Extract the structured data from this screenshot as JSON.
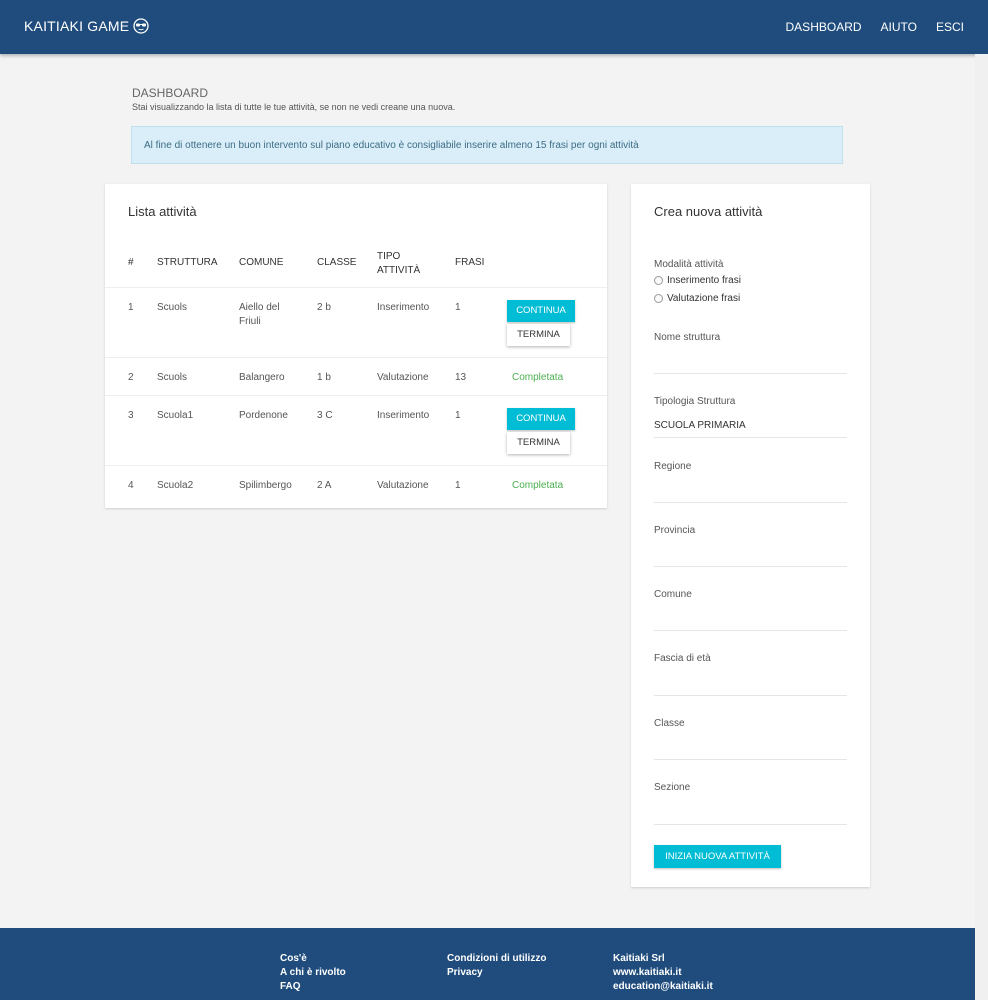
{
  "navbar": {
    "brand": "KAITIAKI GAME",
    "links": [
      "DASHBOARD",
      "AIUTO",
      "ESCI"
    ]
  },
  "page": {
    "title": "DASHBOARD",
    "subtitle": "Stai visualizzando la lista di tutte le tue attività, se non ne vedi creane una nuova."
  },
  "alert": "Al fine di ottenere un buon intervento sul piano educativo è consigliabile inserire almeno 15 frasi per ogni attività",
  "list": {
    "title": "Lista attività",
    "headers": [
      "#",
      "STRUTTURA",
      "COMUNE",
      "CLASSE",
      "TIPO ATTIVITÀ",
      "FRASI"
    ],
    "rows": [
      {
        "num": "1",
        "struttura": "Scuols",
        "comune": "Aiello del Friuli",
        "classe": "2 b",
        "tipo": "Inserimento",
        "frasi": "1",
        "continua": "CONTINUA",
        "termina": "TERMINA"
      },
      {
        "num": "2",
        "struttura": "Scuols",
        "comune": "Balangero",
        "classe": "1 b",
        "tipo": "Valutazione",
        "frasi": "13",
        "status": "Completata"
      },
      {
        "num": "3",
        "struttura": "Scuola1",
        "comune": "Pordenone",
        "classe": "3 C",
        "tipo": "Inserimento",
        "frasi": "1",
        "continua": "CONTINUA",
        "termina": "TERMINA"
      },
      {
        "num": "4",
        "struttura": "Scuola2",
        "comune": "Spilimbergo",
        "classe": "2 A",
        "tipo": "Valutazione",
        "frasi": "1",
        "status": "Completata"
      }
    ]
  },
  "form": {
    "title": "Crea nuova attività",
    "modalita_label": "Modalità attività",
    "modalita_options": [
      "Inserimento frasi",
      "Valutazione frasi"
    ],
    "fields": {
      "nome_struttura": "Nome struttura",
      "tipologia": "Tipologia Struttura",
      "tipologia_value": "SCUOLA PRIMARIA",
      "regione": "Regione",
      "provincia": "Provincia",
      "comune": "Comune",
      "fascia": "Fascia di età",
      "classe": "Classe",
      "sezione": "Sezione"
    },
    "submit": "INIZIA NUOVA ATTIVITÀ"
  },
  "footer": {
    "col1": [
      "Cos'è",
      "A chi è rivolto",
      "FAQ"
    ],
    "col2": [
      "Condizioni di utilizzo",
      "Privacy"
    ],
    "col3": [
      "Kaitiaki Srl",
      "www.kaitiaki.it",
      "education@kaitiaki.it"
    ]
  },
  "colors": {
    "primary": "#1f4c7c",
    "accent": "#00bcd4",
    "success": "#4caf50",
    "alert_bg": "#d9eef8"
  }
}
